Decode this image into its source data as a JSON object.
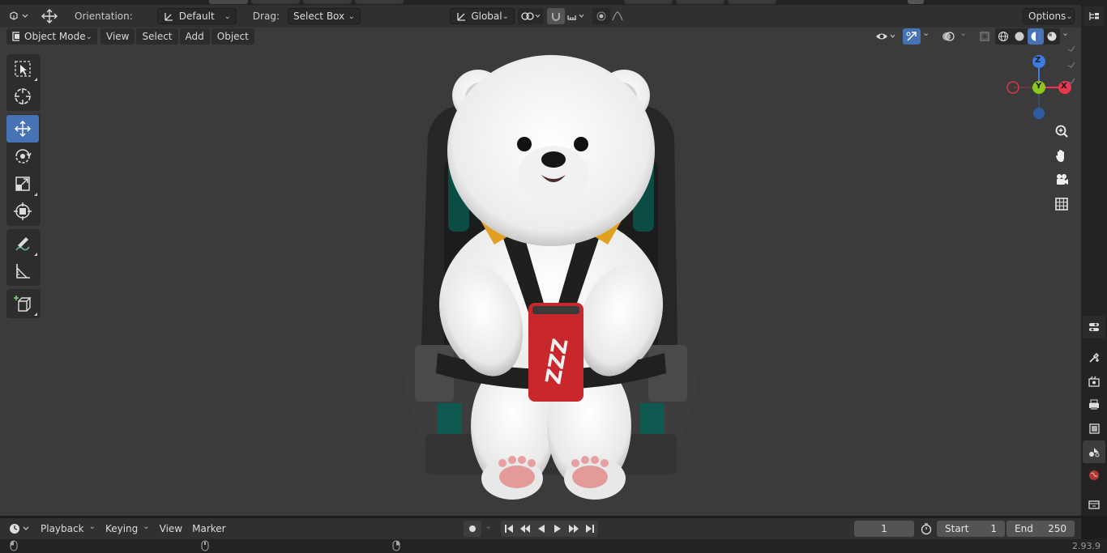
{
  "tool_settings": {
    "orientation_label": "Orientation:",
    "orientation_value": "Default",
    "drag_label": "Drag:",
    "drag_value": "Select Box",
    "transform_orientation": "Global",
    "options_label": "Options"
  },
  "header": {
    "mode": "Object Mode",
    "menus": [
      "View",
      "Select",
      "Add",
      "Object"
    ]
  },
  "gizmo": {
    "z": "Z",
    "y": "Y",
    "x": "X"
  },
  "timeline": {
    "menus": [
      "Playback",
      "Keying",
      "View",
      "Marker"
    ],
    "current_frame": "1",
    "start_label": "Start",
    "start_value": "1",
    "end_label": "End",
    "end_value": "250"
  },
  "status": {
    "version": "2.93.9"
  },
  "colors": {
    "accent": "#4772b3",
    "viewport_bg": "#3b3b3b",
    "axis_x": "#e8384f",
    "axis_y": "#8bc81d",
    "axis_z": "#3b7de0"
  },
  "icons": {
    "editor_type": "viewport-editor-icon",
    "move_gizmo": "transform-move-icon",
    "pivot": "pivot-icon",
    "snap": "magnet-icon",
    "proportional": "proportional-edit-icon"
  }
}
